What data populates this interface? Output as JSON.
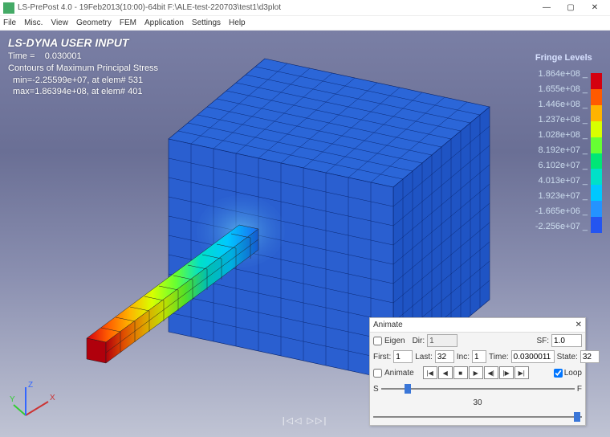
{
  "window": {
    "title": "LS-PrePost 4.0 - 19Feb2013(10:00)-64bit  F:\\ALE-test-220703\\test1\\d3plot"
  },
  "menu": [
    "File",
    "Misc.",
    "View",
    "Geometry",
    "FEM",
    "Application",
    "Settings",
    "Help"
  ],
  "overlay": {
    "title": "LS-DYNA USER INPUT",
    "time_label": "Time =",
    "time_value": "0.030001",
    "contour_type": "Contours of Maximum Principal Stress",
    "min_line": "min=-2.25599e+07, at elem# 531",
    "max_line": "max=1.86394e+08, at elem# 401"
  },
  "fringe": {
    "title": "Fringe Levels",
    "levels": [
      {
        "value": "1.864e+08",
        "color": "#d4000f"
      },
      {
        "value": "1.655e+08",
        "color": "#ff5a00"
      },
      {
        "value": "1.446e+08",
        "color": "#ffb300"
      },
      {
        "value": "1.237e+08",
        "color": "#d8ff00"
      },
      {
        "value": "1.028e+08",
        "color": "#66ff33"
      },
      {
        "value": "8.192e+07",
        "color": "#00e676"
      },
      {
        "value": "6.102e+07",
        "color": "#00e0c8"
      },
      {
        "value": "4.013e+07",
        "color": "#00c8ff"
      },
      {
        "value": "1.923e+07",
        "color": "#2493ff"
      },
      {
        "value": "-1.665e+06",
        "color": "#2455f0"
      },
      {
        "value": "-2.256e+07",
        "color": "#1a2ed8"
      }
    ]
  },
  "animate": {
    "panel_title": "Animate",
    "eigen_label": "Eigen",
    "dir_label": "Dir:",
    "dir_value": "1",
    "sf_label": "SF:",
    "sf_value": "1.0",
    "first_label": "First:",
    "first_value": "1",
    "last_label": "Last:",
    "last_value": "32",
    "inc_label": "Inc:",
    "inc_value": "1",
    "time_label": "Time:",
    "time_value": "0.0300011",
    "state_label": "State:",
    "state_value": "32",
    "animate_label": "Animate",
    "loop_label": "Loop",
    "s_label": "S",
    "f_label": "F",
    "speed_value": "30"
  },
  "triad": {
    "x": "X",
    "y": "Y",
    "z": "Z"
  },
  "playback_glyph": "|◁◁ ▷▷|"
}
